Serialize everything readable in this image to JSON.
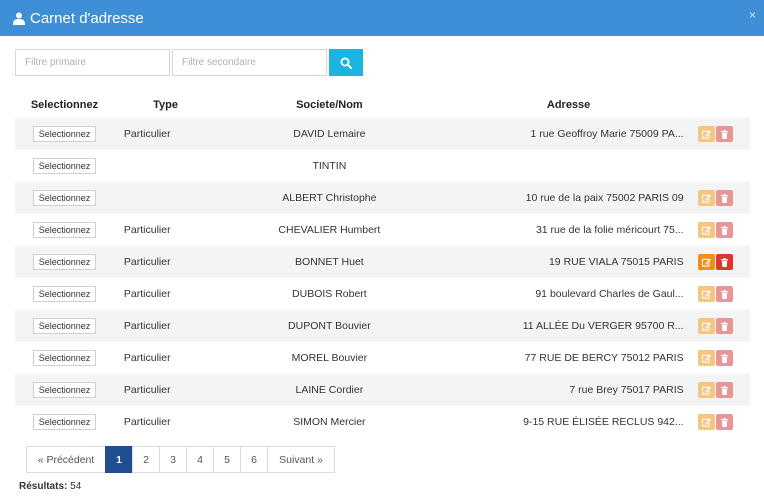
{
  "modal": {
    "title": "Carnet d'adresse",
    "close": "×"
  },
  "filters": {
    "primary_placeholder": "Filtre primaire",
    "secondary_placeholder": "Filtre secondaire"
  },
  "table": {
    "headers": {
      "select": "Selectionnez",
      "type": "Type",
      "name": "Societe/Nom",
      "address": "Adresse"
    },
    "select_label": "Selectionnez",
    "rows": [
      {
        "type": "Particulier",
        "name": "DAVID Lemaire",
        "address": "1 rue Geoffroy Marie 75009 PA..."
      },
      {
        "type": "",
        "name": "TINTIN",
        "address": ""
      },
      {
        "type": "",
        "name": "ALBERT Christophe",
        "address": "10 rue de la paix 75002 PARIS 09"
      },
      {
        "type": "Particulier",
        "name": "CHEVALIER Humbert",
        "address": "31 rue de la folie méricourt 75..."
      },
      {
        "type": "Particulier",
        "name": "BONNET Huet",
        "address": "19 RUE VIALA 75015 PARIS"
      },
      {
        "type": "Particulier",
        "name": "DUBOIS Robert",
        "address": "91 boulevard Charles de Gaul..."
      },
      {
        "type": "Particulier",
        "name": "DUPONT Bouvier",
        "address": "11 ALLÉE Du VERGER 95700 R..."
      },
      {
        "type": "Particulier",
        "name": "MOREL Bouvier",
        "address": "77 RUE DE BERCY 75012 PARIS"
      },
      {
        "type": "Particulier",
        "name": "LAINE Cordier",
        "address": "7 rue Brey 75017 PARIS"
      },
      {
        "type": "Particulier",
        "name": "SIMON Mercier",
        "address": "9-15 RUE ÉLISÉE RECLUS 942..."
      }
    ]
  },
  "pagination": {
    "prev": "« Précédent",
    "pages": [
      "1",
      "2",
      "3",
      "4",
      "5",
      "6"
    ],
    "next": "Suivant »"
  },
  "results": {
    "label": "Résultats:",
    "count": "54"
  },
  "colors": {
    "header": "#3e8fd6",
    "search": "#1bb3df",
    "edit": "#f3c77f",
    "delete": "#e99595",
    "page_active": "#1f4f91"
  }
}
